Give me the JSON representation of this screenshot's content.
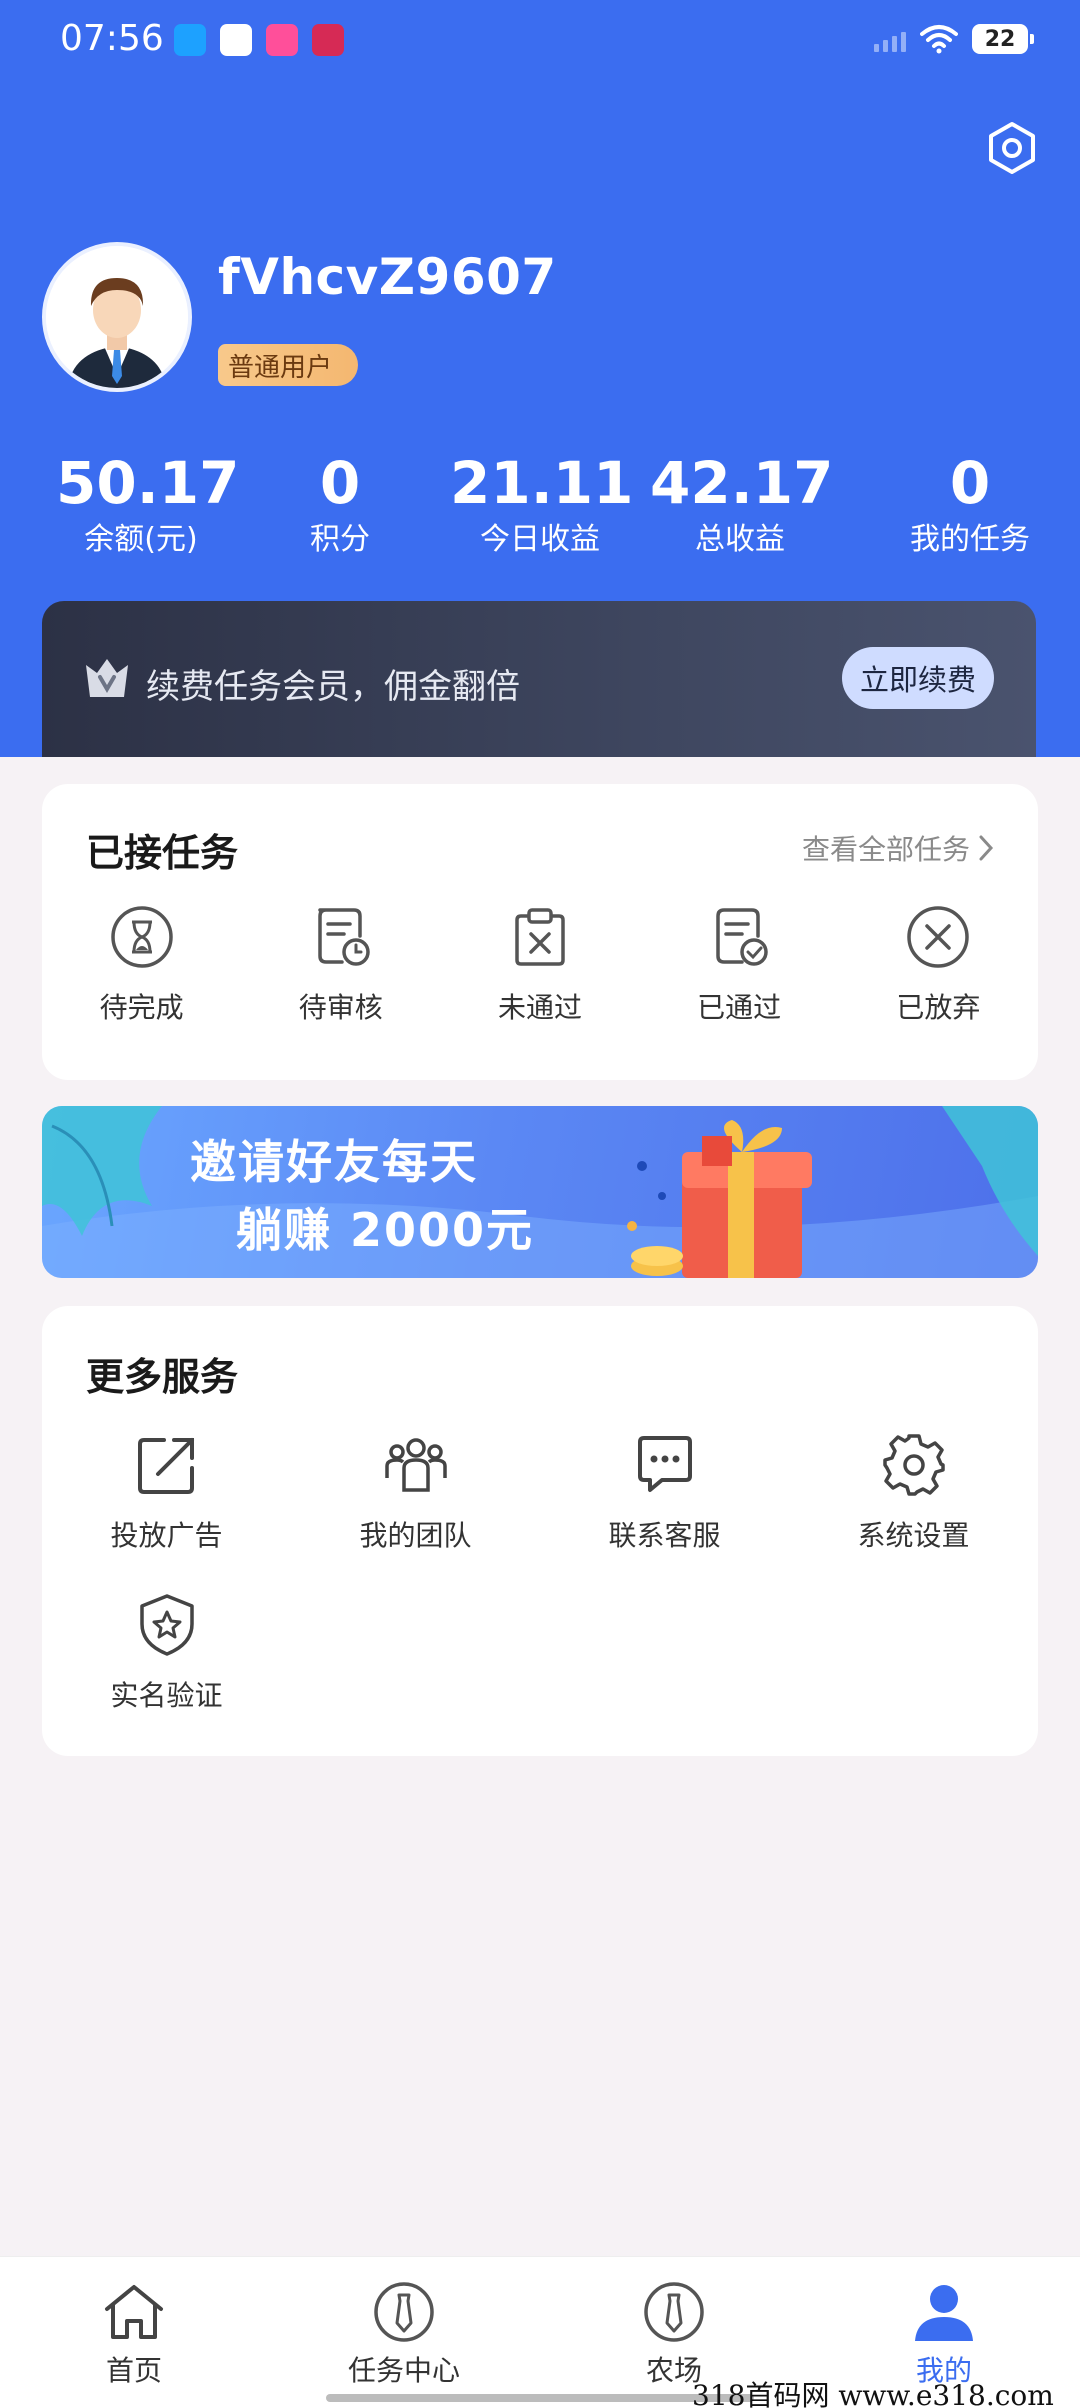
{
  "status_bar": {
    "time": "07:56",
    "battery": "22"
  },
  "profile": {
    "username": "fVhcvZ9607",
    "badge": "普通用户"
  },
  "stats": [
    {
      "value": "50.17",
      "label": "余额(元)"
    },
    {
      "value": "0",
      "label": "积分"
    },
    {
      "value": "21.11",
      "label": "今日收益"
    },
    {
      "value": "42.17",
      "label": "总收益"
    },
    {
      "value": "0",
      "label": "我的任务"
    }
  ],
  "vip": {
    "text": "续费任务会员，佣金翻倍",
    "button": "立即续费"
  },
  "tasks": {
    "title": "已接任务",
    "view_all": "查看全部任务",
    "items": [
      {
        "label": "待完成",
        "icon": "hourglass-icon"
      },
      {
        "label": "待审核",
        "icon": "doc-clock-icon"
      },
      {
        "label": "未通过",
        "icon": "clipboard-x-icon"
      },
      {
        "label": "已通过",
        "icon": "doc-check-icon"
      },
      {
        "label": "已放弃",
        "icon": "circle-x-icon"
      }
    ]
  },
  "invite_banner": {
    "line1": "邀请好友每天",
    "line2": "躺赚 2000元"
  },
  "services": {
    "title": "更多服务",
    "items": [
      {
        "label": "投放广告",
        "icon": "external-link-icon"
      },
      {
        "label": "我的团队",
        "icon": "team-icon"
      },
      {
        "label": "联系客服",
        "icon": "chat-icon"
      },
      {
        "label": "系统设置",
        "icon": "gear-icon"
      },
      {
        "label": "实名验证",
        "icon": "shield-star-icon"
      }
    ]
  },
  "nav": [
    {
      "label": "首页",
      "icon": "home-icon"
    },
    {
      "label": "任务中心",
      "icon": "task-center-icon"
    },
    {
      "label": "农场",
      "icon": "farm-icon"
    },
    {
      "label": "我的",
      "icon": "user-icon",
      "active": true
    }
  ],
  "colors": {
    "primary": "#3b6df0",
    "background": "#f6f2f5",
    "vip_dark": "#2c3145"
  },
  "watermark": "318首码网  www.e318.com"
}
